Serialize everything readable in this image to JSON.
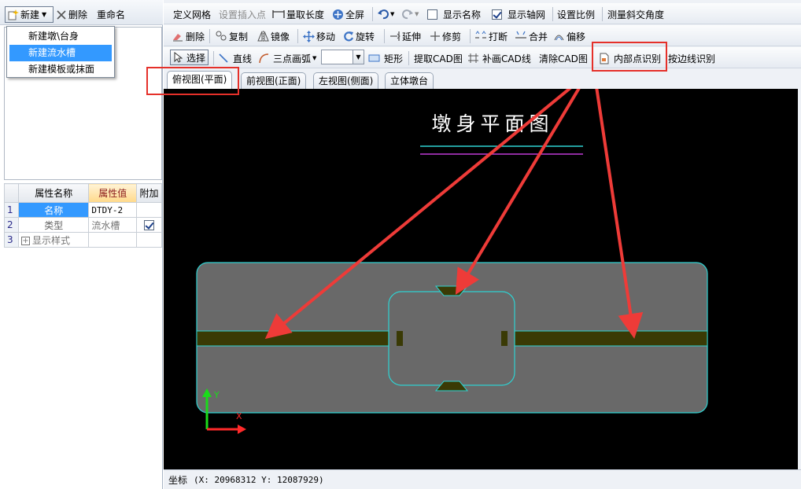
{
  "left_toolbar": {
    "new_label": "新建",
    "delete_label": "删除",
    "rename_label": "重命名"
  },
  "new_menu": {
    "items": [
      "新建墩\\台身",
      "新建流水槽",
      "新建模板或抹面"
    ],
    "selected_index": 1
  },
  "properties": {
    "headers": [
      "属性名称",
      "属性值",
      "附加"
    ],
    "rows": [
      {
        "num": "1",
        "name": "名称",
        "value": "DTDY-2",
        "extra": ""
      },
      {
        "num": "2",
        "name": "类型",
        "value": "流水槽",
        "extra": "checked"
      },
      {
        "num": "3",
        "name": "显示样式",
        "value": "",
        "extra": ""
      }
    ]
  },
  "toolbar1": {
    "define_grid": "定义网格",
    "set_insert_point": "设置插入点",
    "measure_length": "量取长度",
    "fullscreen": "全屏",
    "show_name": "显示名称",
    "show_axis": "显示轴网",
    "set_scale": "设置比例",
    "measure_angle": "测量斜交角度"
  },
  "toolbar2": {
    "delete": "删除",
    "copy": "复制",
    "mirror": "镜像",
    "move": "移动",
    "rotate": "旋转",
    "extend": "延伸",
    "trim": "修剪",
    "break": "打断",
    "merge": "合并",
    "offset": "偏移"
  },
  "toolbar3": {
    "select": "选择",
    "line": "直线",
    "arc3": "三点画弧",
    "rect": "矩形",
    "extract_cad": "提取CAD图",
    "add_cad_line": "补画CAD线",
    "clear_cad": "清除CAD图",
    "inner_point": "内部点识别",
    "edge_line": "按边线识别"
  },
  "view_tabs": [
    "俯视图(平面)",
    "前视图(正面)",
    "左视图(侧面)",
    "立体墩台"
  ],
  "canvas": {
    "drawing_title": "墩身平面图",
    "axis_x": "X",
    "axis_y": "Y"
  },
  "status": {
    "label": "坐标",
    "coords": "(X: 20968312 Y: 12087929)"
  },
  "colors": {
    "canvas_bg": "#000000",
    "shape_fill": "#696969",
    "outline": "#2fd2d2",
    "groove": "#3a3a05",
    "arrow_red": "#ee3b38",
    "highlight_box": "#e5302a"
  }
}
